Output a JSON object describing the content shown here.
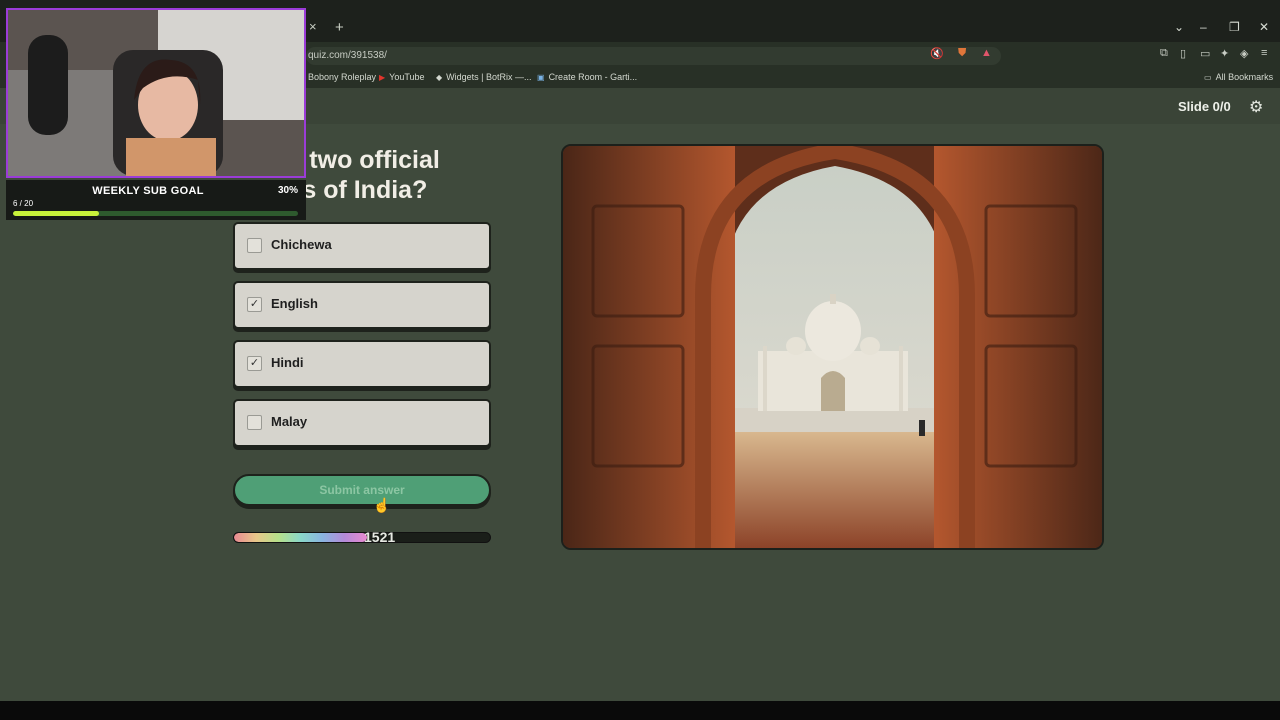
{
  "browser": {
    "tab_close": "×",
    "new_tab": "+",
    "url": "quiz.com/391538/",
    "bookmarks": [
      {
        "label": "Bobony Roleplay"
      },
      {
        "label": "YouTube"
      },
      {
        "label": "Widgets | BotRix —..."
      },
      {
        "label": "Create Room - Garti..."
      }
    ],
    "all_bookmarks": "All Bookmarks"
  },
  "header": {
    "slide_label": "Slide 0/0"
  },
  "quiz": {
    "question": "e the two official\nuages of India?",
    "options": [
      {
        "label": "Chichewa",
        "checked": false
      },
      {
        "label": "English",
        "checked": true
      },
      {
        "label": "Hindi",
        "checked": true
      },
      {
        "label": "Malay",
        "checked": false
      }
    ],
    "submit_label": "Submit answer",
    "timer_value": "1521",
    "timer_progress": 0.52
  },
  "overlay": {
    "sub_goal_title": "WEEKLY SUB GOAL",
    "sub_goal_percent": "30%",
    "sub_goal_count": "6 / 20",
    "sub_goal_progress": 0.3
  },
  "colors": {
    "accent": "#4f9f76",
    "page_bg": "#3f4a3c",
    "stream_frame": "#9b3cd8",
    "sub_goal_fill": "#c8f23a"
  }
}
